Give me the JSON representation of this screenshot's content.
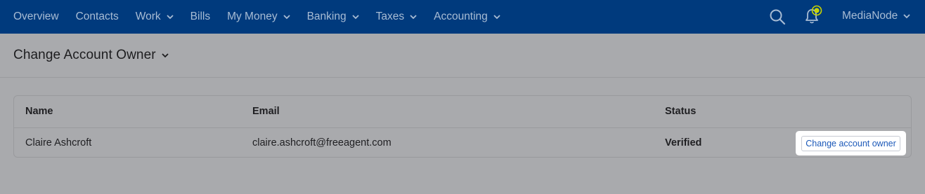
{
  "nav": {
    "items": [
      {
        "label": "Overview",
        "dropdown": false
      },
      {
        "label": "Contacts",
        "dropdown": false
      },
      {
        "label": "Work",
        "dropdown": true
      },
      {
        "label": "Bills",
        "dropdown": false
      },
      {
        "label": "My Money",
        "dropdown": true
      },
      {
        "label": "Banking",
        "dropdown": true
      },
      {
        "label": "Taxes",
        "dropdown": true
      },
      {
        "label": "Accounting",
        "dropdown": true
      }
    ],
    "account_label": "MediaNode",
    "icons": [
      "search-icon",
      "bell-icon"
    ]
  },
  "page": {
    "title": "Change Account Owner"
  },
  "table": {
    "headers": {
      "name": "Name",
      "email": "Email",
      "status": "Status"
    },
    "rows": [
      {
        "name": "Claire Ashcroft",
        "email": "claire.ashcroft@freeagent.com",
        "status": "Verified",
        "action_label": "Change account owner"
      }
    ]
  },
  "colors": {
    "nav_bg": "#003a7d",
    "nav_text": "#a8bcd4",
    "overlay_bg": "#a9aaad",
    "link_blue": "#1b58b8",
    "notification_dot": "#c8d400"
  }
}
